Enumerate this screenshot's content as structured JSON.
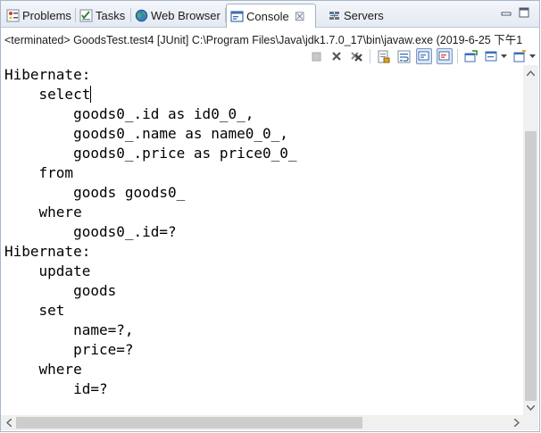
{
  "tabs": [
    {
      "label": "Problems",
      "icon": "problems-icon"
    },
    {
      "label": "Tasks",
      "icon": "tasks-icon"
    },
    {
      "label": "Web Browser",
      "icon": "globe-icon"
    },
    {
      "label": "Console",
      "icon": "console-icon",
      "active": true,
      "close": "☒"
    },
    {
      "label": "Servers",
      "icon": "servers-icon"
    }
  ],
  "status": {
    "terminated_text": "<terminated> GoodsTest.test4 [JUnit] C:\\Program Files\\Java\\jdk1.7.0_17\\bin\\javaw.exe (2019-6-25 下午1"
  },
  "toolbar": {
    "buttons": [
      "terminate-icon",
      "remove-launch-icon",
      "remove-all-terminated-icon",
      "scroll-lock-icon",
      "word-wrap-icon",
      "show-on-stdout-icon",
      "show-on-stderr-icon",
      "pin-console-icon",
      "display-selected-console-icon",
      "open-console-icon"
    ]
  },
  "console": {
    "lines": [
      "Hibernate: ",
      "    select",
      "        goods0_.id as id0_0_,",
      "        goods0_.name as name0_0_,",
      "        goods0_.price as price0_0_ ",
      "    from",
      "        goods goods0_ ",
      "    where",
      "        goods0_.id=?",
      "Hibernate: ",
      "    update",
      "        goods ",
      "    set",
      "        name=?,",
      "        price=? ",
      "    where",
      "        id=?"
    ]
  },
  "colors": {
    "accent": "#3c6eb4",
    "tab_bar": "#e4eaf2",
    "scroll_thumb": "#cdcdcd"
  }
}
